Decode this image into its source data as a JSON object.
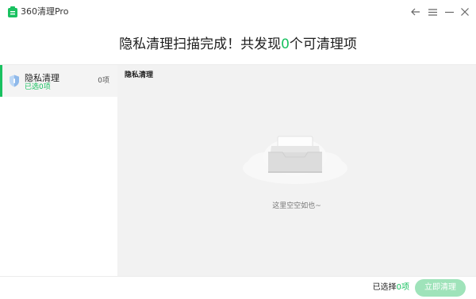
{
  "titlebar": {
    "app_title": "360清理Pro",
    "icons": [
      "app-logo-icon",
      "back-arrow-icon",
      "menu-icon",
      "minimize-icon",
      "close-icon"
    ]
  },
  "header": {
    "headline_prefix": "隐私清理扫描完成！共发现",
    "headline_count": "0",
    "headline_suffix": "个可清理项"
  },
  "sidebar": {
    "items": [
      {
        "label": "隐私清理",
        "sub": "已选0项",
        "count": "0项",
        "icon": "shield-icon"
      }
    ]
  },
  "main": {
    "section_title": "隐私清理",
    "empty_text": "这里空空如也~",
    "empty_icon": "empty-box-icon"
  },
  "footer": {
    "selected_prefix": "已选择",
    "selected_count": "0项",
    "clean_button": "立即清理"
  },
  "colors": {
    "accent": "#19c160",
    "button_disabled": "#9fe3ba",
    "panel_bg": "#f2f2f2"
  }
}
